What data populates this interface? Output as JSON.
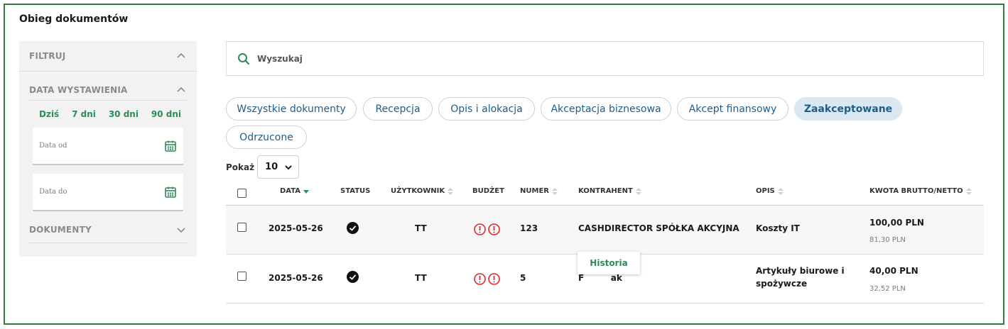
{
  "page": {
    "title": "Obieg dokumentów"
  },
  "sidebar": {
    "filter_label": "FILTRUJ",
    "date_section": {
      "label": "DATA WYSTAWIENIA",
      "quick": [
        "Dziś",
        "7 dni",
        "30 dni",
        "90 dni"
      ],
      "from_placeholder": "Data od",
      "to_placeholder": "Data do"
    },
    "documents_label": "DOKUMENTY"
  },
  "search": {
    "placeholder": "Wyszukaj"
  },
  "tabs": [
    {
      "label": "Wszystkie dokumenty",
      "active": false
    },
    {
      "label": "Recepcja",
      "active": false
    },
    {
      "label": "Opis i alokacja",
      "active": false
    },
    {
      "label": "Akceptacja biznesowa",
      "active": false
    },
    {
      "label": "Akcept finansowy",
      "active": false
    },
    {
      "label": "Zaakceptowane",
      "active": true
    },
    {
      "label": "Odrzucone",
      "active": false
    }
  ],
  "show": {
    "label": "Pokaż",
    "value": "10"
  },
  "table": {
    "columns": {
      "data": "DATA",
      "status": "STATUS",
      "user": "UŻYTKOWNIK",
      "budget": "BUDŻET",
      "number": "NUMER",
      "contractor": "KONTRAHENT",
      "description": "OPIS",
      "amount": "KWOTA BRUTTO/NETTO"
    },
    "rows": [
      {
        "date": "2025-05-26",
        "user": "TT",
        "number": "123",
        "contractor": "CASHDIRECTOR SPÓŁKA AKCYJNA",
        "description": "Koszty IT",
        "gross": "100,00  PLN",
        "net": "81,30 PLN"
      },
      {
        "date": "2025-05-26",
        "user": "TT",
        "number": "5",
        "contractor": "F         ak",
        "description_line1": "Artykuły biurowe i",
        "description_line2": "spożywcze",
        "gross": "40,00  PLN",
        "net": "32,52 PLN"
      }
    ],
    "tooltip": "Historia"
  },
  "colors": {
    "accent_green": "#2e8b57",
    "frame_green": "#2e7d32",
    "tab_text": "#1f5d8c",
    "active_tab_bg": "#d9e8f3",
    "warning_red": "#d32f2f"
  }
}
